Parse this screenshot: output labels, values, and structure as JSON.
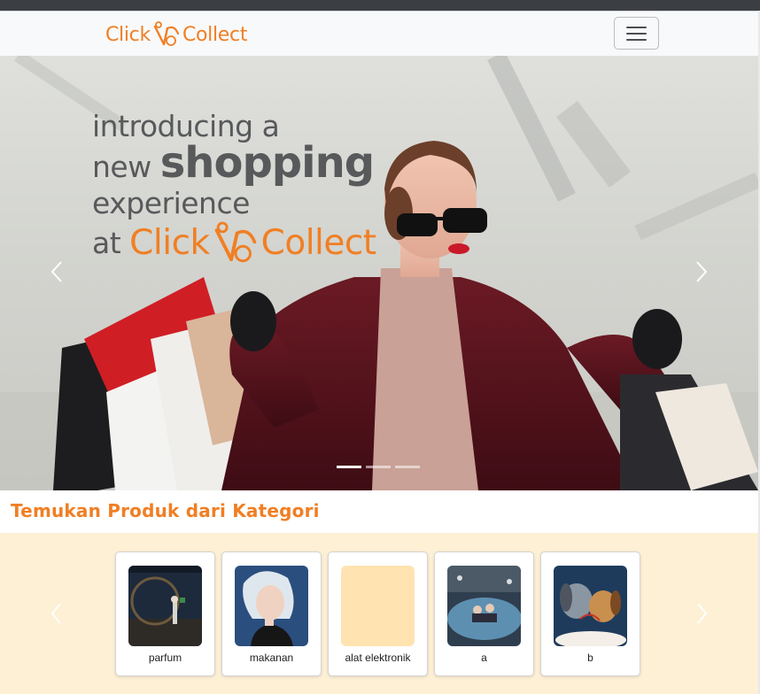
{
  "navbar": {
    "brand_left": "Click",
    "brand_right": "Collect",
    "toggler_icon": "hamburger-icon"
  },
  "hero": {
    "line1": "introducing a",
    "line2_prefix": "new",
    "line2_big": "shopping",
    "line3": "experience",
    "line4_prefix": "at",
    "brand_left": "Click",
    "brand_right": "Collect",
    "prev_icon": "chevron-left-icon",
    "next_icon": "chevron-right-icon",
    "slide_count": 3,
    "active_slide": 1
  },
  "categories": {
    "title": "Temukan Produk dari Kategori",
    "items": [
      {
        "label": "parfum"
      },
      {
        "label": "makanan"
      },
      {
        "label": "alat elektronik"
      },
      {
        "label": "a"
      },
      {
        "label": "b"
      }
    ]
  },
  "colors": {
    "accent": "#f07f24",
    "category_background": "#fdf0d5",
    "navbar_background": "#f8f9fa"
  }
}
